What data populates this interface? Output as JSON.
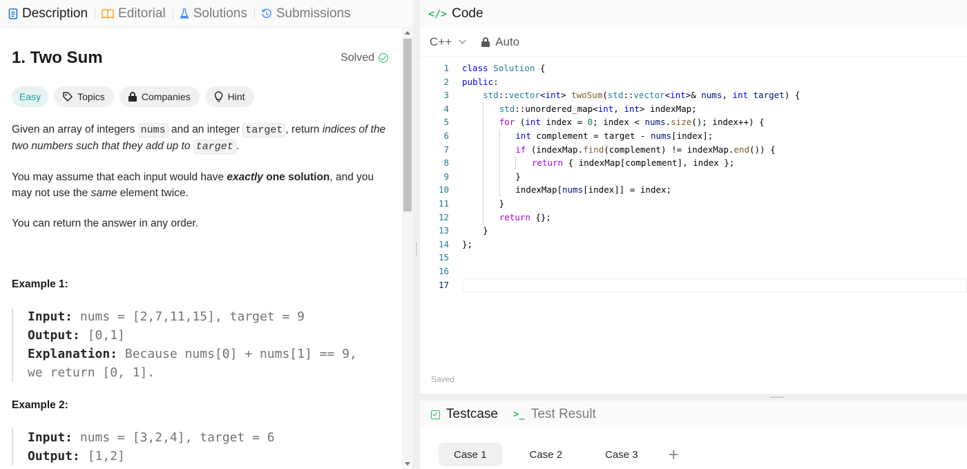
{
  "left_tabs": [
    {
      "label": "Description"
    },
    {
      "label": "Editorial"
    },
    {
      "label": "Solutions"
    },
    {
      "label": "Submissions"
    }
  ],
  "problem": {
    "title": "1. Two Sum",
    "status": "Solved",
    "chips": {
      "difficulty": "Easy",
      "topics": "Topics",
      "companies": "Companies",
      "hint": "Hint"
    },
    "desc_p1": {
      "a": "Given an array of integers ",
      "nums": "nums",
      "b": " and an integer ",
      "target": "target",
      "c": ", return ",
      "d": "indices of the two numbers such that they add up to ",
      "target2": "target",
      "e": "."
    },
    "desc_p2": {
      "a": "You may assume that each input would have ",
      "b": "exactly",
      "c": " one solution",
      "d": ", and you may not use the ",
      "e": "same",
      "f": " element twice."
    },
    "desc_p3": "You can return the answer in any order.",
    "examples": [
      {
        "heading": "Example 1:",
        "input_label": "Input:",
        "input": " nums = [2,7,11,15], target = 9",
        "output_label": "Output:",
        "output": " [0,1]",
        "expl_label": "Explanation:",
        "expl_1": " Because nums[0] + nums[1] == 9,",
        "expl_2": "we return [0, 1]."
      },
      {
        "heading": "Example 2:",
        "input_label": "Input:",
        "input": " nums = [3,2,4], target = 6",
        "output_label": "Output:",
        "output": " [1,2]"
      }
    ]
  },
  "code_panel": {
    "title": "Code",
    "title_glyph": "</>",
    "language": "C++",
    "mode": "Auto",
    "status": "Saved",
    "line_numbers": [
      "1",
      "2",
      "3",
      "4",
      "5",
      "6",
      "7",
      "8",
      "9",
      "10",
      "11",
      "12",
      "13",
      "14",
      "15",
      "16",
      "17"
    ],
    "current_line": 17
  },
  "test_panel": {
    "tabs": [
      {
        "label": "Testcase"
      },
      {
        "label": "Test Result"
      }
    ],
    "term_glyph": ">_",
    "cases": [
      "Case 1",
      "Case 2",
      "Case 3"
    ],
    "add_glyph": "+"
  },
  "colors": {
    "accent_green": "#2cbb5d",
    "easy": "#1aa7a0",
    "keyword": "#0000ff",
    "type": "#267f99"
  }
}
